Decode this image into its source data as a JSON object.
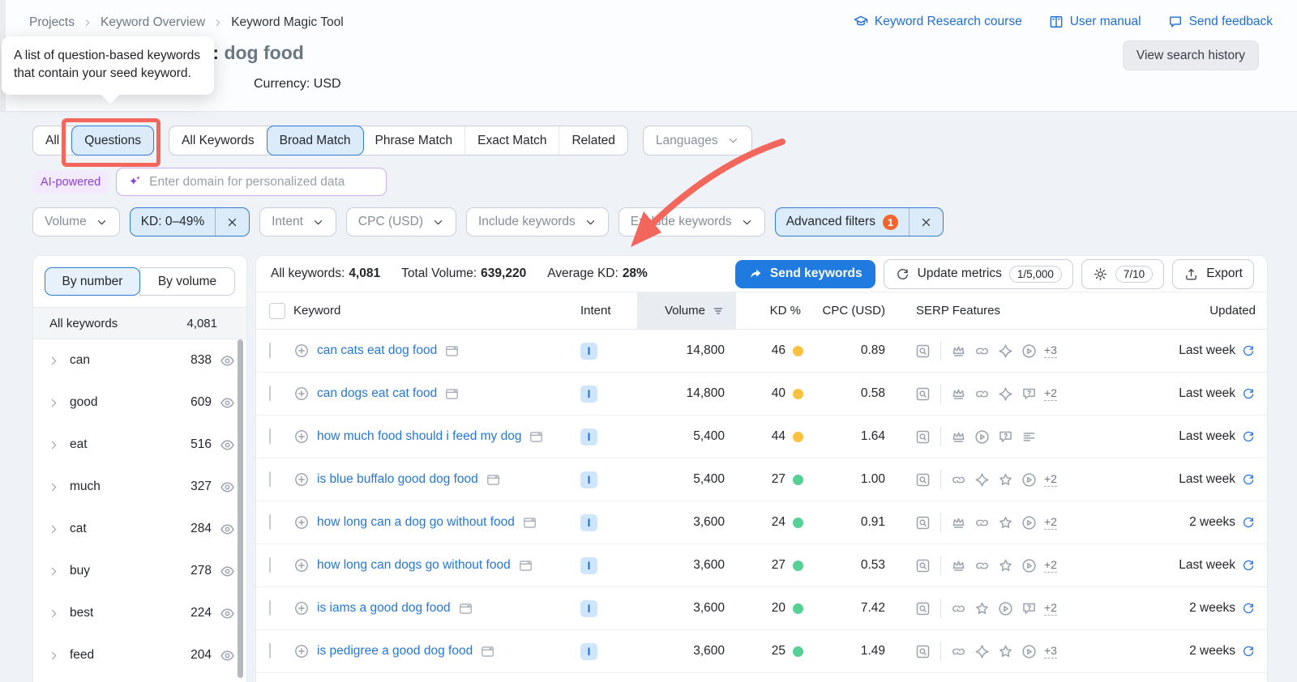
{
  "colors": {
    "link_blue": "#2577d6",
    "accent_blue": "#2f7cd6",
    "active_bg": "#dcebfa",
    "annotation_red": "#f2665c",
    "kd_orange": "#fcc13e",
    "kd_green": "#56d095",
    "intent_badge_bg": "#cfe5fb",
    "intent_badge_text": "#1d6ac6",
    "purple": "#8a3fd7",
    "filter_badge_orange": "#f2652f",
    "send_button_bg": "#1f7be0"
  },
  "breadcrumb": {
    "items": [
      "Projects",
      "Keyword Overview",
      "Keyword Magic Tool"
    ]
  },
  "header_links": [
    {
      "icon": "graduation-cap",
      "label": "Keyword Research course"
    },
    {
      "icon": "book",
      "label": "User manual"
    },
    {
      "icon": "feedback",
      "label": "Send feedback"
    }
  ],
  "view_search_history": "View search history",
  "title": {
    "prefix": "l:",
    "keyword": "dog food"
  },
  "currency": "Currency: USD",
  "tooltip": {
    "text": "A list of question-based keywords that contain your seed keyword."
  },
  "tabs": {
    "group1": [
      {
        "label": "All",
        "active": false
      },
      {
        "label": "Questions",
        "active": true
      }
    ],
    "group2": [
      {
        "label": "All Keywords",
        "active": false
      },
      {
        "label": "Broad Match",
        "active": true
      },
      {
        "label": "Phrase Match",
        "active": false
      },
      {
        "label": "Exact Match",
        "active": false
      },
      {
        "label": "Related",
        "active": false
      }
    ],
    "languages": "Languages"
  },
  "ai_bar": {
    "chip": "AI-powered",
    "placeholder": "Enter domain for personalized data"
  },
  "filters": [
    {
      "label": "Volume",
      "type": "dropdown"
    },
    {
      "label": "KD: 0–49%",
      "type": "active-x"
    },
    {
      "label": "Intent",
      "type": "dropdown"
    },
    {
      "label": "CPC (USD)",
      "type": "dropdown"
    },
    {
      "label": "Include keywords",
      "type": "dropdown"
    },
    {
      "label": "Exclude keywords",
      "type": "dropdown"
    },
    {
      "label": "Advanced filters",
      "type": "advanced",
      "badge": "1"
    }
  ],
  "sidebar": {
    "toggle": [
      {
        "label": "By number",
        "active": true
      },
      {
        "label": "By volume",
        "active": false
      }
    ],
    "header": {
      "label": "All keywords",
      "count": "4,081"
    },
    "items": [
      {
        "label": "can",
        "count": "838"
      },
      {
        "label": "good",
        "count": "609"
      },
      {
        "label": "eat",
        "count": "516"
      },
      {
        "label": "much",
        "count": "327"
      },
      {
        "label": "cat",
        "count": "284"
      },
      {
        "label": "buy",
        "count": "278"
      },
      {
        "label": "best",
        "count": "224"
      },
      {
        "label": "feed",
        "count": "204"
      }
    ]
  },
  "stats": [
    {
      "label": "All keywords:",
      "value": "4,081"
    },
    {
      "label": "Total Volume:",
      "value": "639,220"
    },
    {
      "label": "Average KD:",
      "value": "28%"
    }
  ],
  "actions": {
    "send": "Send keywords",
    "update": "Update metrics",
    "update_quota": "1/5,000",
    "gear_quota": "7/10",
    "export": "Export"
  },
  "table": {
    "columns": [
      "Keyword",
      "Intent",
      "Volume",
      "KD %",
      "CPC (USD)",
      "SERP Features",
      "Updated"
    ],
    "rows": [
      {
        "keyword": "can cats eat dog food",
        "intent": "I",
        "volume": "14,800",
        "kd": "46",
        "kd_color": "orange",
        "cpc": "0.89",
        "features": [
          "crown",
          "link",
          "four-point-star",
          "play-circle"
        ],
        "more": "+3",
        "updated": "Last week"
      },
      {
        "keyword": "can dogs eat cat food",
        "intent": "I",
        "volume": "14,800",
        "kd": "40",
        "kd_color": "orange",
        "cpc": "0.58",
        "features": [
          "crown",
          "link",
          "four-point-star",
          "chat-question"
        ],
        "more": "+2",
        "updated": "Last week"
      },
      {
        "keyword": "how much food should i feed my dog",
        "intent": "I",
        "volume": "5,400",
        "kd": "44",
        "kd_color": "orange",
        "cpc": "1.64",
        "features": [
          "crown",
          "play-circle",
          "chat-question",
          "sitelinks"
        ],
        "more": null,
        "updated": "Last week"
      },
      {
        "keyword": "is blue buffalo good dog food",
        "intent": "I",
        "volume": "5,400",
        "kd": "27",
        "kd_color": "green",
        "cpc": "1.00",
        "features": [
          "link",
          "four-point-star",
          "star",
          "play-circle"
        ],
        "more": "+2",
        "updated": "Last week"
      },
      {
        "keyword": "how long can a dog go without food",
        "intent": "I",
        "volume": "3,600",
        "kd": "24",
        "kd_color": "green",
        "cpc": "0.91",
        "features": [
          "crown",
          "link",
          "star",
          "play-circle"
        ],
        "more": "+2",
        "updated": "2 weeks"
      },
      {
        "keyword": "how long can dogs go without food",
        "intent": "I",
        "volume": "3,600",
        "kd": "27",
        "kd_color": "green",
        "cpc": "0.53",
        "features": [
          "crown",
          "link",
          "star",
          "play-circle"
        ],
        "more": "+2",
        "updated": "Last week"
      },
      {
        "keyword": "is iams a good dog food",
        "intent": "I",
        "volume": "3,600",
        "kd": "20",
        "kd_color": "green",
        "cpc": "7.42",
        "features": [
          "link",
          "star",
          "play-circle",
          "chat-question"
        ],
        "more": "+2",
        "updated": "2 weeks"
      },
      {
        "keyword": "is pedigree a good dog food",
        "intent": "I",
        "volume": "3,600",
        "kd": "25",
        "kd_color": "green",
        "cpc": "1.49",
        "features": [
          "link",
          "four-point-star",
          "star",
          "play-circle"
        ],
        "more": "+3",
        "updated": "2 weeks"
      }
    ]
  }
}
